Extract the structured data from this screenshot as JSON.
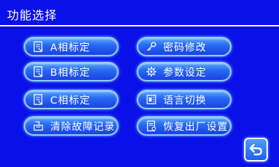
{
  "header": {
    "title": "功能选择"
  },
  "buttons": {
    "a_calibrate": {
      "label": "A相标定",
      "icon": "calibrate-doc-icon"
    },
    "b_calibrate": {
      "label": "B相标定",
      "icon": "calibrate-doc-icon"
    },
    "c_calibrate": {
      "label": "C相标定",
      "icon": "calibrate-doc-icon"
    },
    "clear_faults": {
      "label": "清除故障记录",
      "icon": "eraser-icon"
    },
    "password": {
      "label": "密码修改",
      "icon": "key-icon"
    },
    "params": {
      "label": "参数设定",
      "icon": "gear-icon"
    },
    "language": {
      "label": "语言切换",
      "icon": "language-icon"
    },
    "factory_reset": {
      "label": "恢复出厂设置",
      "icon": "reset-doc-icon"
    },
    "back": {
      "icon": "back-arrow-icon"
    }
  },
  "colors": {
    "background": "#0a10e8",
    "button_border": "#8fd0ff",
    "text": "#ffffff"
  }
}
